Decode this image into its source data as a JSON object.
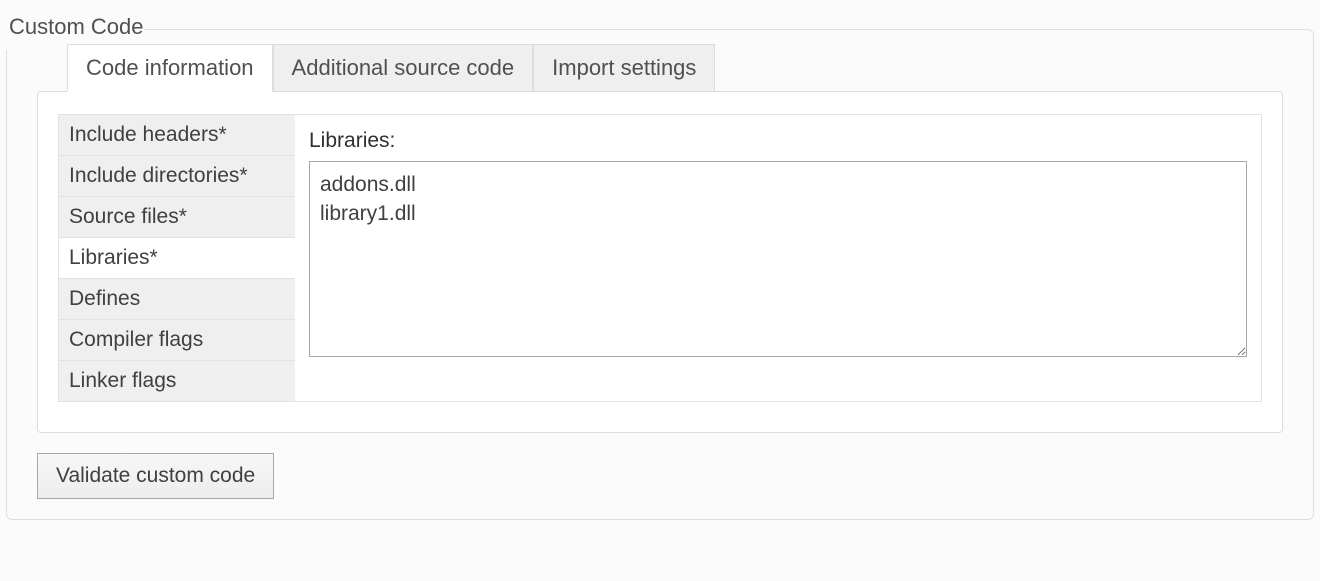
{
  "panel": {
    "title": "Custom Code"
  },
  "topTabs": [
    {
      "label": "Code information",
      "active": true
    },
    {
      "label": "Additional source code",
      "active": false
    },
    {
      "label": "Import settings",
      "active": false
    }
  ],
  "sideTabs": [
    {
      "label": "Include headers*",
      "active": false
    },
    {
      "label": "Include directories*",
      "active": false
    },
    {
      "label": "Source files*",
      "active": false
    },
    {
      "label": "Libraries*",
      "active": true
    },
    {
      "label": "Defines",
      "active": false
    },
    {
      "label": "Compiler flags",
      "active": false
    },
    {
      "label": "Linker flags",
      "active": false
    }
  ],
  "detail": {
    "label": "Libraries:",
    "value": "addons.dll\nlibrary1.dll"
  },
  "buttons": {
    "validate": "Validate custom code"
  }
}
